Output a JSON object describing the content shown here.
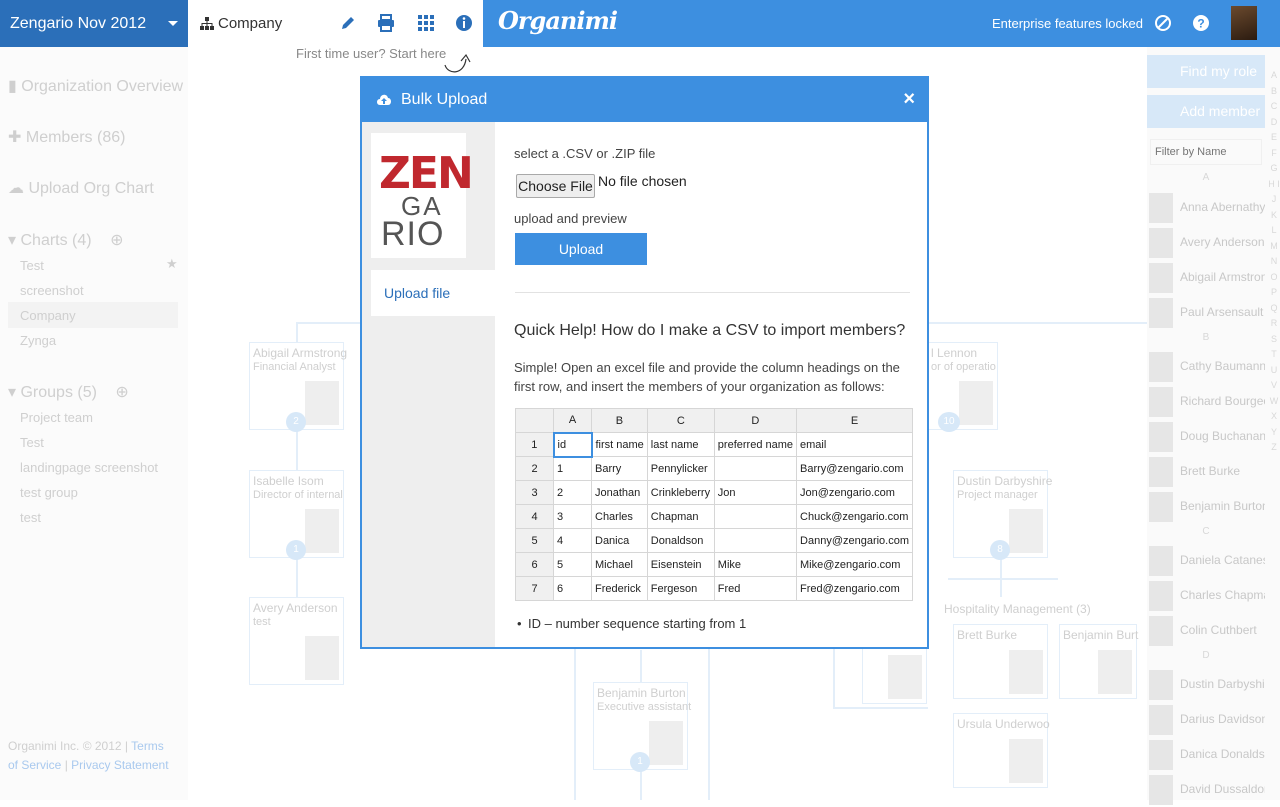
{
  "topbar": {
    "org_name": "Zengario Nov 2012",
    "chart_tab": "Company",
    "first_time": "First time user? Start here",
    "brand": "Organimi",
    "locked": "Enterprise features locked"
  },
  "sidebar": {
    "overview": "Organization Overview",
    "members": "Members (86)",
    "upload": "Upload Org Chart",
    "charts": "Charts (4)",
    "chart_items": [
      "Test",
      "screenshot",
      "Company",
      "Zynga"
    ],
    "groups": "Groups (5)",
    "group_items": [
      "Project team",
      "Test",
      "landingpage screenshot",
      "test group",
      "test"
    ],
    "footer_company": "Organimi Inc. © 2012 |",
    "terms": "Terms",
    "of_service": "of Service",
    "privacy": "Privacy Statement"
  },
  "right_panel": {
    "find_role": "Find my role",
    "add_member": "Add member",
    "filter_placeholder": "Filter by Name",
    "sec_a": "A",
    "sec_b": "B",
    "sec_c": "C",
    "sec_d": "D",
    "members": [
      "Anna Abernathy",
      "Avery Anderson",
      "Abigail Armstron",
      "Paul Arsensault",
      "Cathy Baumann",
      "Richard Bourgeo",
      "Doug Buchanan",
      "Brett Burke",
      "Benjamin Burton",
      "Daniela Catanes",
      "Charles Chapma",
      "Colin Cuthbert",
      "Dustin Darbyshi",
      "Darius Davidson",
      "Danica Donaldsc",
      "David Dussaldor"
    ],
    "letters": "A B C D E F G H I J K L M N O P Q R S T U V W X Y Z"
  },
  "background_chart": {
    "cards": [
      {
        "name": "Abigail Armstrong",
        "title": "Financial Analyst",
        "badge": "2"
      },
      {
        "name": "Isabelle Isom",
        "title": "Director of internal",
        "badge": "1"
      },
      {
        "name": "Avery Anderson",
        "title": "test",
        "badge": ""
      },
      {
        "name": "l Lennon",
        "title": "or of operatio",
        "badge": "10"
      },
      {
        "name": "Dustin Darbyshire",
        "title": "Project manager",
        "badge": "8"
      },
      {
        "name": "Benjamin Burton",
        "title": "Executive assistant",
        "badge": "1"
      },
      {
        "name": "Brett Burke",
        "title": "",
        "badge": ""
      },
      {
        "name": "Benjamin Burt",
        "title": "",
        "badge": ""
      },
      {
        "name": "Ursula Underwoo",
        "title": "",
        "badge": ""
      }
    ],
    "group_label": "Hospitality Management (3)"
  },
  "modal": {
    "title": "Bulk Upload",
    "close": "×",
    "logo_line1": "ZEN",
    "logo_line2": "GA",
    "logo_line3": "RIO",
    "side_tab": "Upload file",
    "select_label": "select a .CSV or .ZIP file",
    "choose_button": "Choose File",
    "no_file": "No file chosen",
    "upload_label": "upload and preview",
    "upload_button": "Upload",
    "help_title": "Quick Help! How do I make a CSV to import members?",
    "help_text": "Simple! Open an excel file and provide the column headings on the first row, and insert the members of your organization as follows:",
    "bullet": "ID – number sequence starting from 1",
    "sheet_cols": [
      "A",
      "B",
      "C",
      "D",
      "E"
    ],
    "sheet_rows": [
      [
        "1",
        "id",
        "first name",
        "last name",
        "preferred name",
        "email"
      ],
      [
        "2",
        "1",
        "Barry",
        "Pennylicker",
        "",
        "Barry@zengario.com"
      ],
      [
        "3",
        "2",
        "Jonathan",
        "Crinkleberry",
        "Jon",
        "Jon@zengario.com"
      ],
      [
        "4",
        "3",
        "Charles",
        "Chapman",
        "",
        "Chuck@zengario.com"
      ],
      [
        "5",
        "4",
        "Danica",
        "Donaldson",
        "",
        "Danny@zengario.com"
      ],
      [
        "6",
        "5",
        "Michael",
        "Eisenstein",
        "Mike",
        "Mike@zengario.com"
      ],
      [
        "7",
        "6",
        "Frederick",
        "Fergeson",
        "Fred",
        "Fred@zengario.com"
      ]
    ]
  },
  "colors": {
    "accent": "#3d8fe0",
    "dark_accent": "#2b6fb9"
  }
}
